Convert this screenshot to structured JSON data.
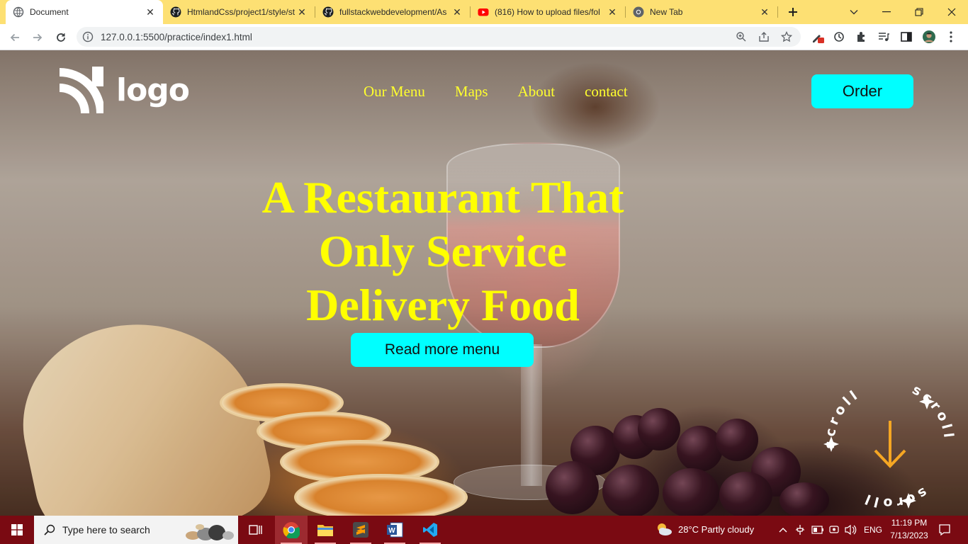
{
  "browser": {
    "tabs": [
      {
        "title": "Document",
        "favicon": "globe-icon",
        "active": true
      },
      {
        "title": "HtmlandCss/project1/style/st",
        "favicon": "github-icon",
        "active": false
      },
      {
        "title": "fullstackwebdevelopment/As",
        "favicon": "github-icon",
        "active": false
      },
      {
        "title": "(816) How to upload files/fol",
        "favicon": "youtube-icon",
        "active": false
      },
      {
        "title": "New Tab",
        "favicon": "chrome-icon",
        "active": false
      }
    ],
    "url": "127.0.0.1:5500/practice/index1.html"
  },
  "page": {
    "logo_text": "logo",
    "nav": [
      "Our Menu",
      "Maps",
      "About",
      "contact"
    ],
    "order_button": "Order",
    "hero_lines": [
      "A Restaurant That",
      "Only Service",
      "Delivery Food"
    ],
    "read_more_button": "Read more menu",
    "scroll_badge_text": "scroll",
    "colors": {
      "accent_button": "#00ffff",
      "headline": "#ffff00",
      "nav": "#ffff2e",
      "scroll_arrow": "#f5a623"
    }
  },
  "taskbar": {
    "search_placeholder": "Type here to search",
    "weather": "28°C  Partly cloudy",
    "language": "ENG",
    "time": "11:19 PM",
    "date": "7/13/2023",
    "colors": {
      "background": "#7a0a12"
    }
  }
}
